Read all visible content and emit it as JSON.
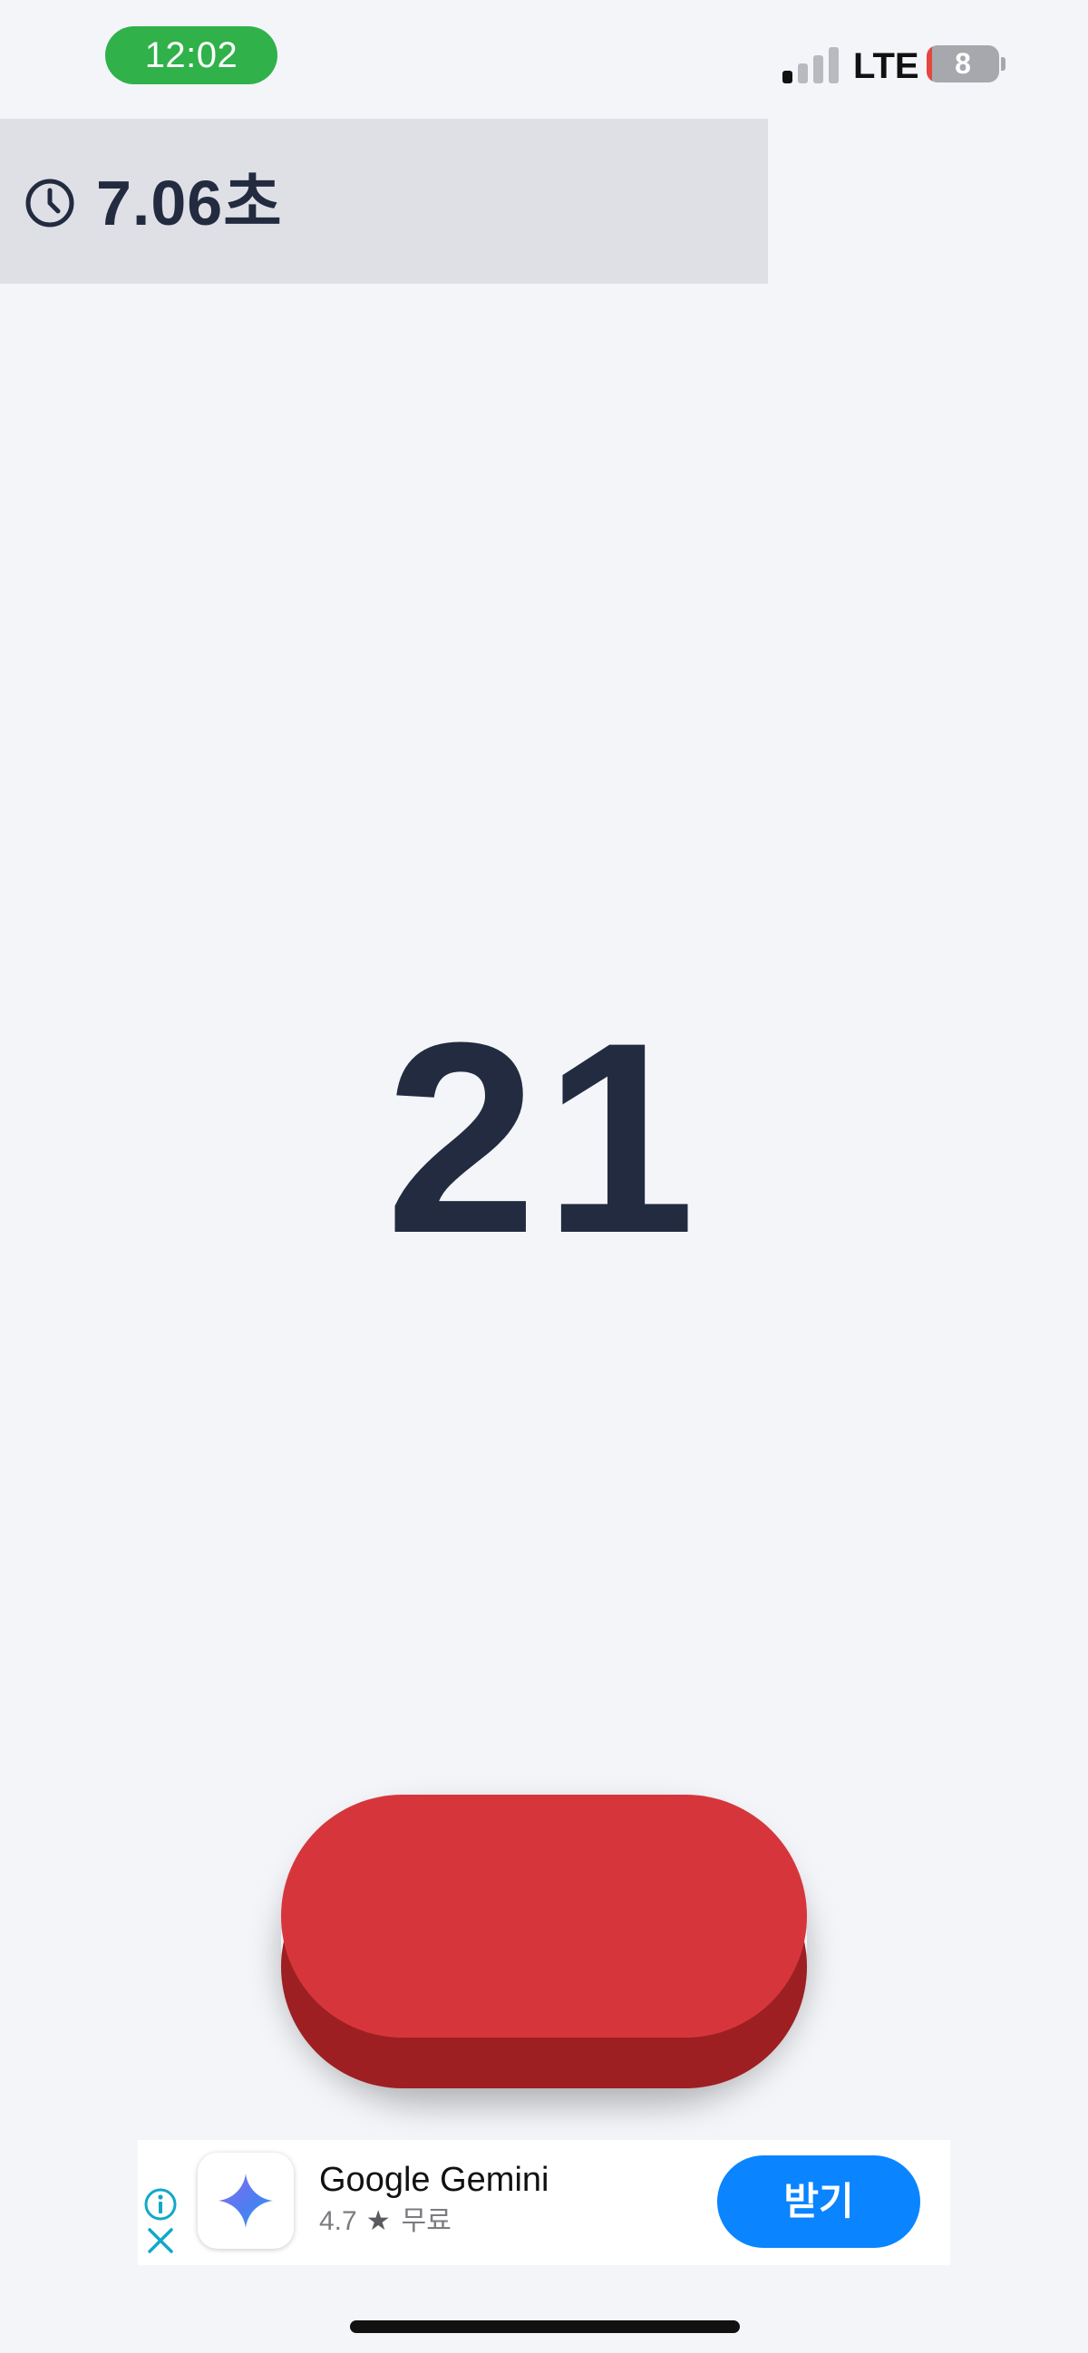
{
  "status_bar": {
    "time": "12:02",
    "time_pill_color": "#30b14a",
    "network": "LTE",
    "signal_bars_active": 1,
    "signal_bars_total": 4,
    "battery_level": "8",
    "battery_fraction": 0.08,
    "battery_low_color": "#e5463d"
  },
  "timer": {
    "icon": "clock-icon",
    "value": "7.06초"
  },
  "counter": {
    "value": "21"
  },
  "tap_button": {
    "color_top": "#d6363b",
    "color_base": "#9d1f22"
  },
  "ad": {
    "info_icon": "info-icon",
    "close_icon": "close-icon",
    "app_icon": "gemini-sparkle-icon",
    "app_name": "Google Gemini",
    "rating": "4.7",
    "rating_icon": "star-icon",
    "price": "무료",
    "get_label": "받기",
    "button_color": "#0a84ff"
  },
  "colors": {
    "background": "#f3f5f9",
    "timer_panel": "#dfe0e6",
    "text_primary": "#232b40"
  }
}
